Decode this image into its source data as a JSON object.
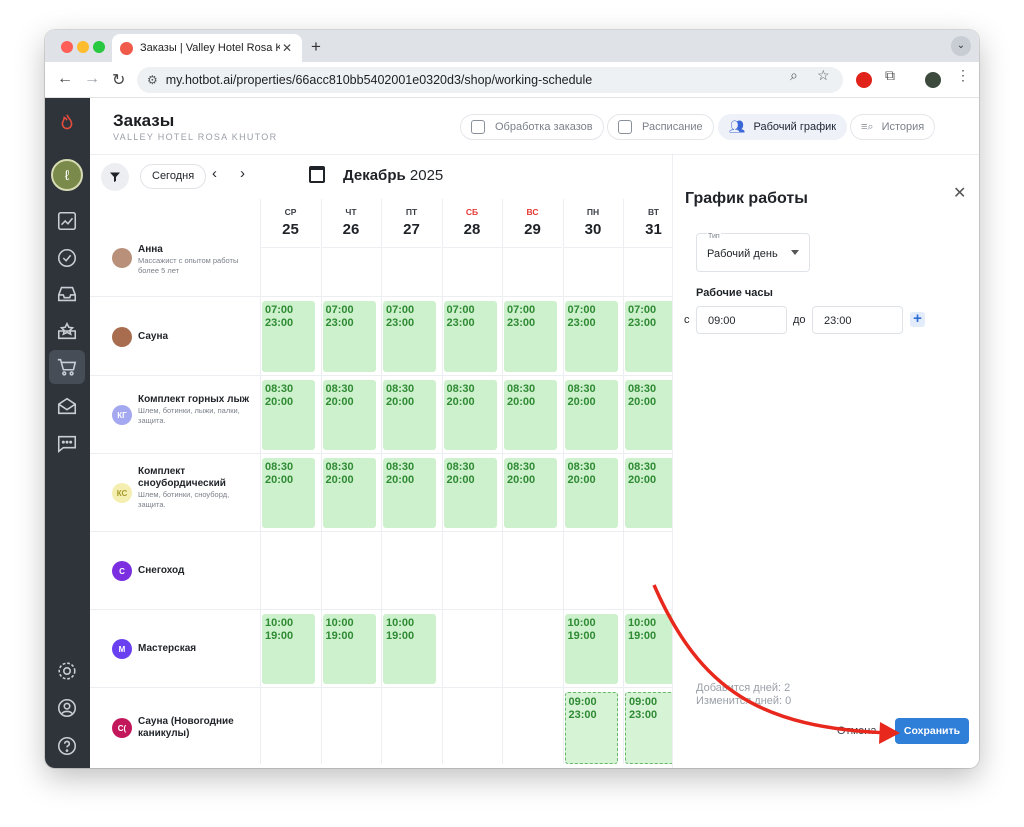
{
  "browser": {
    "tab_title": "Заказы | Valley Hotel Rosa Khutor",
    "url": "my.hotbot.ai/properties/66acc810bb5402001e0320d3/shop/working-schedule"
  },
  "header": {
    "title": "Заказы",
    "subtitle": "VALLEY HOTEL ROSA KHUTOR",
    "tabs": [
      {
        "label": "Обработка заказов",
        "active": false
      },
      {
        "label": "Расписание",
        "active": false
      },
      {
        "label": "Рабочий график",
        "active": true
      },
      {
        "label": "История",
        "active": false
      }
    ]
  },
  "toolbar": {
    "today_label": "Сегодня",
    "month": "Декабрь",
    "year": "2025"
  },
  "days": [
    {
      "dow": "СР",
      "num": "25",
      "weekend": false
    },
    {
      "dow": "ЧТ",
      "num": "26",
      "weekend": false
    },
    {
      "dow": "ПТ",
      "num": "27",
      "weekend": false
    },
    {
      "dow": "СБ",
      "num": "28",
      "weekend": true
    },
    {
      "dow": "ВС",
      "num": "29",
      "weekend": true
    },
    {
      "dow": "ПН",
      "num": "30",
      "weekend": false
    },
    {
      "dow": "ВТ",
      "num": "31",
      "weekend": false
    }
  ],
  "resources": [
    {
      "name": "Анна",
      "desc": "Массажист с опытом работы более 5 лет",
      "initials": "",
      "color": "#b9917a",
      "slots": []
    },
    {
      "name": "Сауна",
      "desc": "",
      "initials": "",
      "color": "#a86c4e",
      "slots": [
        {
          "day": 0,
          "start": "07:00",
          "end": "23:00"
        },
        {
          "day": 1,
          "start": "07:00",
          "end": "23:00"
        },
        {
          "day": 2,
          "start": "07:00",
          "end": "23:00"
        },
        {
          "day": 3,
          "start": "07:00",
          "end": "23:00"
        },
        {
          "day": 4,
          "start": "07:00",
          "end": "23:00"
        },
        {
          "day": 5,
          "start": "07:00",
          "end": "23:00"
        },
        {
          "day": 6,
          "start": "07:00",
          "end": "23:00"
        }
      ]
    },
    {
      "name": "Комплект горных лыж",
      "desc": "Шлем, ботинки, лыжи, палки, защита.",
      "initials": "КГ",
      "color": "#a4a8f0",
      "slots": [
        {
          "day": 0,
          "start": "08:30",
          "end": "20:00"
        },
        {
          "day": 1,
          "start": "08:30",
          "end": "20:00"
        },
        {
          "day": 2,
          "start": "08:30",
          "end": "20:00"
        },
        {
          "day": 3,
          "start": "08:30",
          "end": "20:00"
        },
        {
          "day": 4,
          "start": "08:30",
          "end": "20:00"
        },
        {
          "day": 5,
          "start": "08:30",
          "end": "20:00"
        },
        {
          "day": 6,
          "start": "08:30",
          "end": "20:00"
        }
      ]
    },
    {
      "name": "Комплект сноубордический",
      "desc": "Шлем, ботинки, сноуборд, защита.",
      "initials": "КС",
      "color": "#f4efb0",
      "slots": [
        {
          "day": 0,
          "start": "08:30",
          "end": "20:00"
        },
        {
          "day": 1,
          "start": "08:30",
          "end": "20:00"
        },
        {
          "day": 2,
          "start": "08:30",
          "end": "20:00"
        },
        {
          "day": 3,
          "start": "08:30",
          "end": "20:00"
        },
        {
          "day": 4,
          "start": "08:30",
          "end": "20:00"
        },
        {
          "day": 5,
          "start": "08:30",
          "end": "20:00"
        },
        {
          "day": 6,
          "start": "08:30",
          "end": "20:00"
        }
      ]
    },
    {
      "name": "Снегоход",
      "desc": "",
      "initials": "С",
      "color": "#7b2fe0",
      "slots": []
    },
    {
      "name": "Мастерская",
      "desc": "",
      "initials": "М",
      "color": "#6a3ff0",
      "slots": [
        {
          "day": 0,
          "start": "10:00",
          "end": "19:00"
        },
        {
          "day": 1,
          "start": "10:00",
          "end": "19:00"
        },
        {
          "day": 2,
          "start": "10:00",
          "end": "19:00"
        },
        {
          "day": 5,
          "start": "10:00",
          "end": "19:00"
        },
        {
          "day": 6,
          "start": "10:00",
          "end": "19:00"
        }
      ]
    },
    {
      "name": "Сауна (Новогодние каникулы)",
      "desc": "",
      "initials": "С(",
      "color": "#c2185b",
      "slots": [
        {
          "day": 5,
          "start": "09:00",
          "end": "23:00",
          "pending": true
        },
        {
          "day": 6,
          "start": "09:00",
          "end": "23:00",
          "pending": true
        }
      ]
    }
  ],
  "panel": {
    "title": "График работы",
    "type_label": "Тип",
    "type_value": "Рабочий день",
    "hours_label": "Рабочие часы",
    "from_label": "с",
    "to_label": "до",
    "from_value": "09:00",
    "to_value": "23:00",
    "note_added": "Добавится дней: 2",
    "note_changed": "Изменится дней: 0",
    "cancel_label": "Отмена",
    "save_label": "Сохранить"
  },
  "colors": {
    "sidebar": "#2f343b",
    "slot_bg": "#cdf1cc",
    "slot_text": "#2f8a34",
    "primary": "#2f7ed8",
    "annotation_arrow": "#e8281c"
  }
}
